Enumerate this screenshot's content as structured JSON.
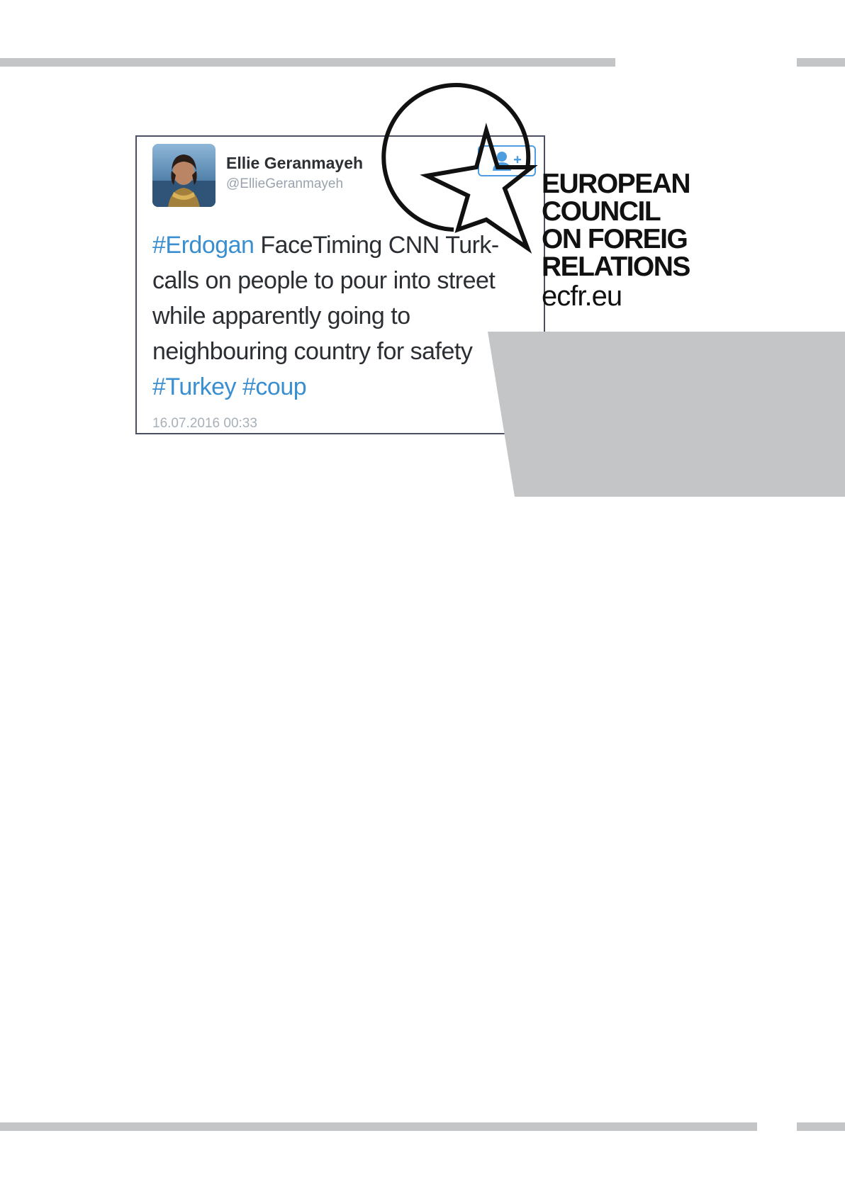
{
  "tweet": {
    "author_name": "Ellie Geranmayeh",
    "author_handle": "@EllieGeranmayeh",
    "text_lines": [
      [
        {
          "t": "#Erdogan",
          "tag": true
        },
        {
          "t": " FaceTiming CNN Turk-",
          "tag": false
        }
      ],
      [
        {
          "t": "calls on people to pour into street",
          "tag": false
        }
      ],
      [
        {
          "t": "while apparently going to",
          "tag": false
        }
      ],
      [
        {
          "t": "neighbouring country for safety",
          "tag": false
        }
      ],
      [
        {
          "t": "#Turkey",
          "tag": true
        },
        {
          "t": " ",
          "tag": false
        },
        {
          "t": "#coup",
          "tag": true
        }
      ]
    ],
    "timestamp": "16.07.2016 00:33",
    "follow_icon": "add-user-icon"
  },
  "logo": {
    "lines": [
      "EUROPEAN",
      "COUNCIL",
      "ON FOREIG",
      "RELATIONS"
    ],
    "url": "ecfr.eu",
    "icon": "circle-star-emblem"
  },
  "colors": {
    "rule": "#c4c5c7",
    "panel": "#c4c5c7",
    "hashtag": "#3a8fd1",
    "follow_accent": "#4d9de0",
    "card_border": "#4a4f63"
  }
}
